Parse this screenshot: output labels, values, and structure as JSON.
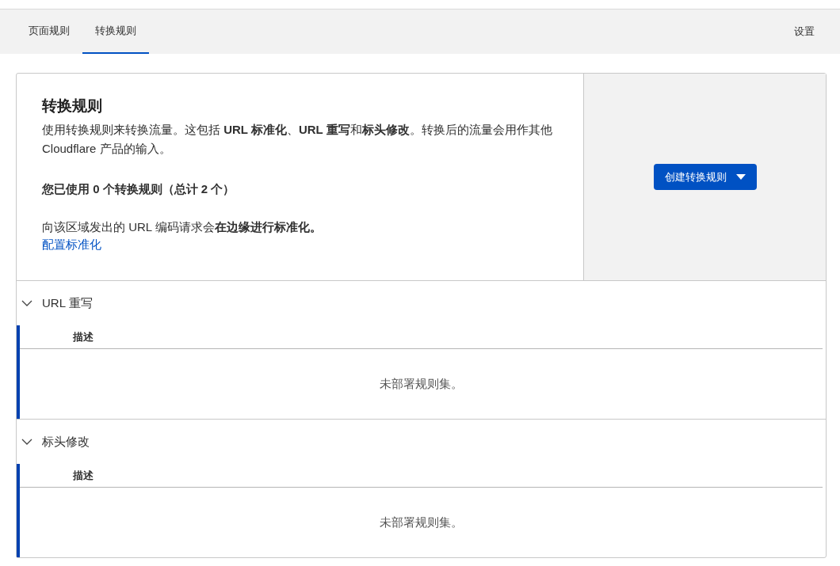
{
  "tabs": [
    {
      "label": "页面规则",
      "selected": false
    },
    {
      "label": "转换规则",
      "selected": true
    }
  ],
  "settings_link": "设置",
  "intro": {
    "title": "转换规则",
    "description": "使用转换规则来转换流量。这包括 **URL 标准化**、**URL 重写**和**标头修改**。转换后的流量会用作其他 Cloudflare 产品的输入。",
    "usage": "您已使用 0 个转换规则（总计 2 个）",
    "normalization_note": "向该区域发出的 URL 编码请求会**在边缘进行标准化。**",
    "configure_link": "配置标准化"
  },
  "create_button": {
    "label": "创建转换规则"
  },
  "sections": [
    {
      "title": "URL 重写",
      "expanded": true,
      "column": "描述",
      "empty_message": "未部署规则集。"
    },
    {
      "title": "标头修改",
      "expanded": true,
      "column": "描述",
      "empty_message": "未部署规则集。"
    }
  ]
}
